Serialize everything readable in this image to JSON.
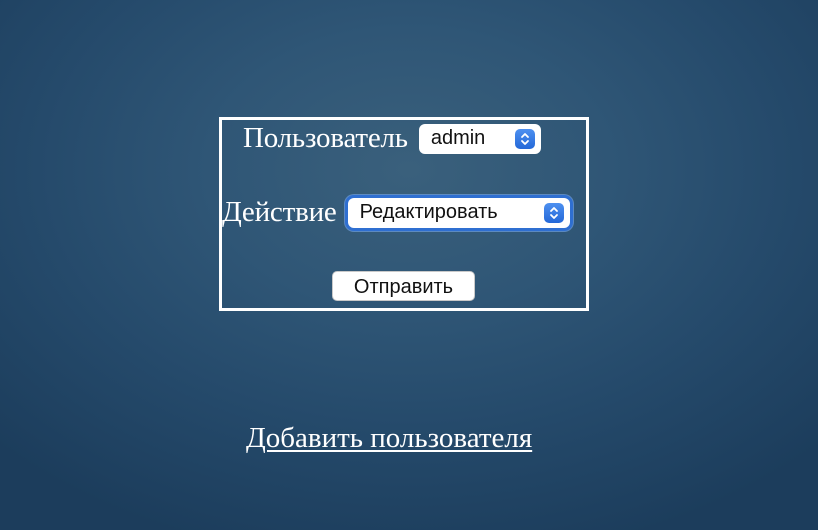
{
  "form": {
    "user_label": "Пользователь",
    "user_selected": "admin",
    "action_label": "Действие",
    "action_selected": "Редактировать",
    "submit_label": "Отправить"
  },
  "links": {
    "add_user": "Добавить пользователя"
  },
  "colors": {
    "background": "#2a5071",
    "accent": "#2f6fd1",
    "text": "#ffffff"
  },
  "icons": {
    "select_stepper": "up-down-chevron-icon"
  }
}
